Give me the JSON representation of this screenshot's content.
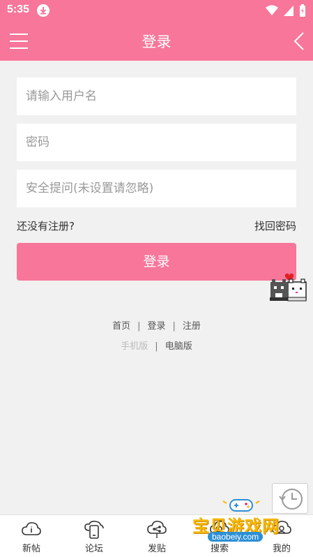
{
  "status_bar": {
    "time": "5:35"
  },
  "header": {
    "title": "登录"
  },
  "form": {
    "username_placeholder": "请输入用户名",
    "password_placeholder": "密码",
    "security_placeholder": "安全提问(未设置请忽略)",
    "register_link": "还没有注册?",
    "forgot_link": "找回密码",
    "login_button": "登录"
  },
  "footer": {
    "links": [
      "首页",
      "登录",
      "注册"
    ],
    "version_mobile": "手机版",
    "version_pc": "电脑版"
  },
  "tabbar": {
    "items": [
      {
        "label": "新帖",
        "icon": "cloud-info-icon"
      },
      {
        "label": "论坛",
        "icon": "phone-icon"
      },
      {
        "label": "发贴",
        "icon": "cloud-share-icon"
      },
      {
        "label": "搜索",
        "icon": "search-icon"
      },
      {
        "label": "我的",
        "icon": "cloud-user-icon"
      }
    ]
  },
  "watermark": {
    "text": "宝贝游戏网",
    "url": "baobeiy.com"
  },
  "colors": {
    "accent": "#f7769a",
    "background": "#f1f1f1"
  }
}
